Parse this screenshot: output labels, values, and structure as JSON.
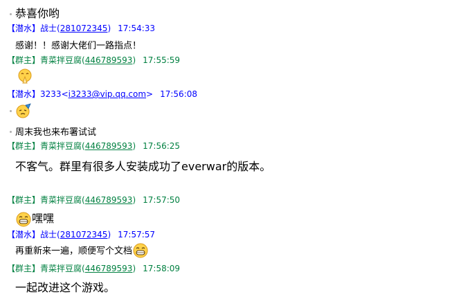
{
  "messages": [
    {
      "text": "恭喜你哟"
    },
    {
      "tag": "【潜水】",
      "name": "战士",
      "open": "(",
      "id": "281072345",
      "close": ")",
      "time": "17:54:33",
      "text": "感谢！！感谢大佬们一路指点！"
    },
    {
      "tag": "【群主】",
      "name": "青菜拌豆腐",
      "open": "(",
      "id": "446789593",
      "close": ")",
      "time": "17:55:59",
      "emoji": "blessing-hands-emoji"
    },
    {
      "tag": "【潜水】",
      "name": "3233",
      "open": "<",
      "id": "i3233@vip.qq.com",
      "close": ">",
      "time": "17:56:08",
      "emoji": "party-face-emoji",
      "text": "周末我也来布署试试"
    },
    {
      "tag": "【群主】",
      "name": "青菜拌豆腐",
      "open": "(",
      "id": "446789593",
      "close": ")",
      "time": "17:56:25",
      "text": "不客气。群里有很多人安装成功了everwar的版本。"
    },
    {
      "tag": "【群主】",
      "name": "青菜拌豆腐",
      "open": "(",
      "id": "446789593",
      "close": ")",
      "time": "17:57:50",
      "emoji": "grin-emoji",
      "text": "嘿嘿"
    },
    {
      "tag": "【潜水】",
      "name": "战士",
      "open": "(",
      "id": "281072345",
      "close": ")",
      "time": "17:57:57",
      "text": "再重新来一遍，顺便写个文档",
      "emoji": "grin-emoji"
    },
    {
      "tag": "【群主】",
      "name": "青菜拌豆腐",
      "open": "(",
      "id": "446789593",
      "close": ")",
      "time": "17:58:09",
      "text": "一起改进这个游戏。"
    }
  ],
  "colors": {
    "member": "#0000ff",
    "owner": "#008040"
  }
}
